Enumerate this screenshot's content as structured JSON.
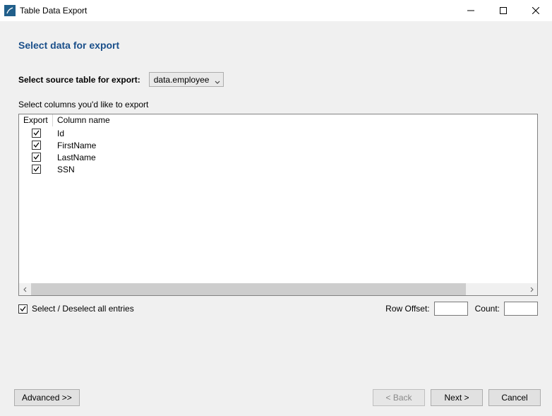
{
  "window": {
    "title": "Table Data Export"
  },
  "heading": "Select data for export",
  "select_table": {
    "label": "Select source table for export:",
    "value": "data.employee"
  },
  "columns_label": "Select columns you'd like to export",
  "table": {
    "header_export": "Export",
    "header_name": "Column name",
    "rows": [
      {
        "checked": true,
        "name": "Id"
      },
      {
        "checked": true,
        "name": "FirstName"
      },
      {
        "checked": true,
        "name": "LastName"
      },
      {
        "checked": true,
        "name": "SSN"
      }
    ]
  },
  "select_all": {
    "checked": true,
    "label": "Select / Deselect all entries"
  },
  "offset": {
    "row_label": "Row Offset:",
    "row_value": "",
    "count_label": "Count:",
    "count_value": ""
  },
  "footer": {
    "advanced": "Advanced >>",
    "back": "< Back",
    "next": "Next >",
    "cancel": "Cancel"
  }
}
